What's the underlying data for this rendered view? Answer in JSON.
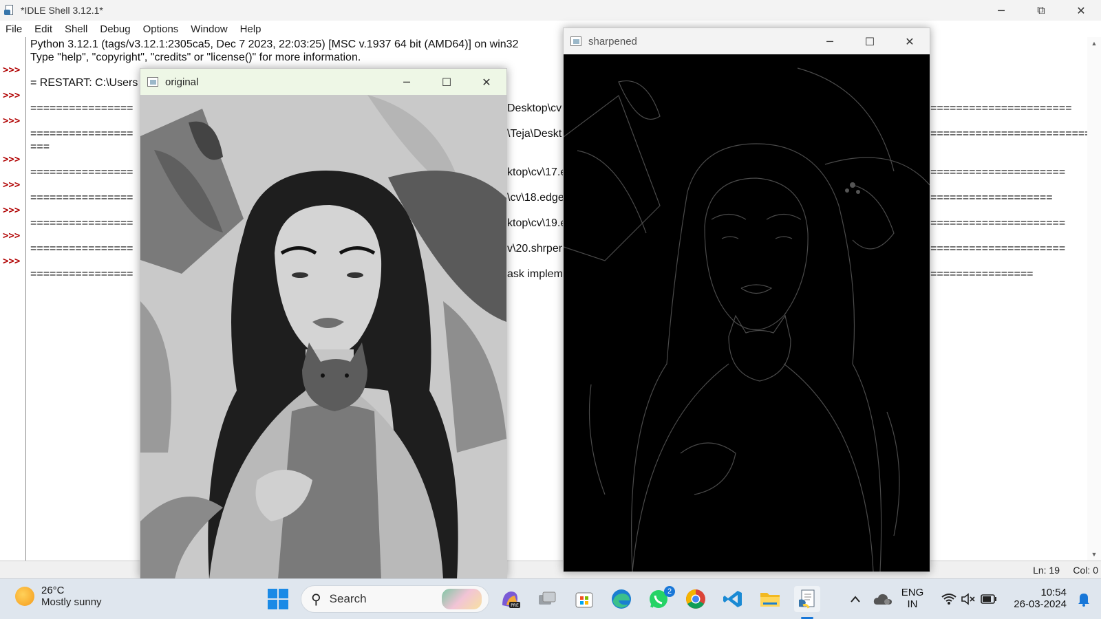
{
  "idle": {
    "title": "*IDLE Shell 3.12.1*",
    "menu": [
      "File",
      "Edit",
      "Shell",
      "Debug",
      "Options",
      "Window",
      "Help"
    ],
    "prompt": ">>>",
    "lines": {
      "l1": "Python 3.12.1 (tags/v3.12.1:2305ca5, Dec  7 2023, 22:03:25) [MSC v.1937 64 bit (AMD64)] on win32",
      "l2": "Type \"help\", \"copyright\", \"credits\" or \"license()\" for more information.",
      "l3": "= RESTART: C:\\Users",
      "l4a": "================",
      "l4b": "Desktop\\cv",
      "l4c": "======================",
      "l5a": "================",
      "l5b": "\\Teja\\Deskt",
      "l5c": "=========================",
      "l5d": "===",
      "l6a": "================",
      "l6b": "ktop\\cv\\17.e",
      "l6c": "=====================",
      "l7a": "================",
      "l7b": "\\cv\\18.edge",
      "l7c": "===================",
      "l8a": "================",
      "l8b": "ktop\\cv\\19.e",
      "l8c": "=====================",
      "l9a": "================",
      "l9b": "v\\20.shrper",
      "l9c": "=====================",
      "l10a": "================",
      "l10b": "ask impleme",
      "l10c": "================"
    },
    "status": {
      "ln": "Ln: 19",
      "col": "Col: 0"
    }
  },
  "original_window": {
    "title": "original"
  },
  "sharpened_window": {
    "title": "sharpened"
  },
  "window_controls": {
    "minimize": "─",
    "maximize": "☐",
    "restore": "⧉",
    "close": "✕"
  },
  "taskbar": {
    "weather_temp": "26°C",
    "weather_condition": "Mostly sunny",
    "search_placeholder": "Search",
    "whatsapp_badge": "2",
    "lang_line1": "ENG",
    "lang_line2": "IN",
    "time": "10:54",
    "date": "26-03-2024"
  },
  "colors": {
    "prompt": "#b00000",
    "taskbar_bg": "#dfe6ee",
    "cv_title_bg_active": "#eef7e6",
    "accent": "#1877d8"
  }
}
